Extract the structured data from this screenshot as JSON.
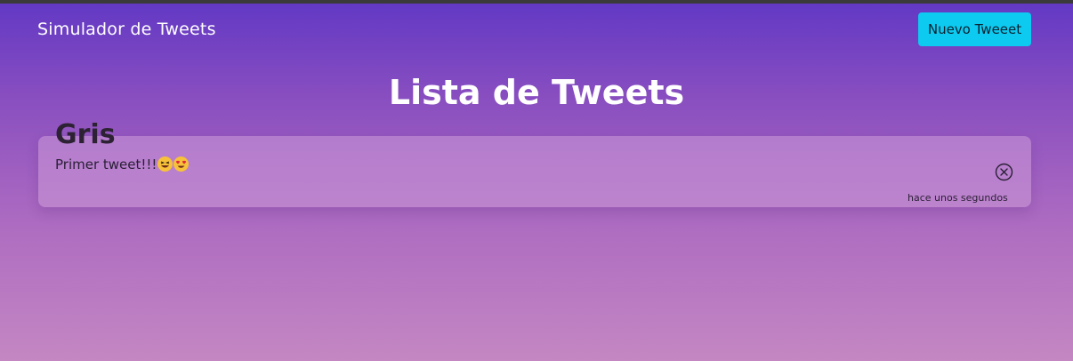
{
  "navbar": {
    "brand": "Simulador de Tweets",
    "new_button_label": "Nuevo Tweeet"
  },
  "page": {
    "title": "Lista de Tweets"
  },
  "tweets": [
    {
      "user": "Gris",
      "text": "Primer tweet!!!",
      "emojis": [
        "laughing-face-emoji",
        "heart-eyes-emoji"
      ],
      "time": "hace unos segundos",
      "delete_icon": "close-circle-icon"
    }
  ],
  "colors": {
    "accent_button": "#0dcaf0",
    "gradient_top": "#6138c4",
    "gradient_bottom": "#c487c2"
  }
}
